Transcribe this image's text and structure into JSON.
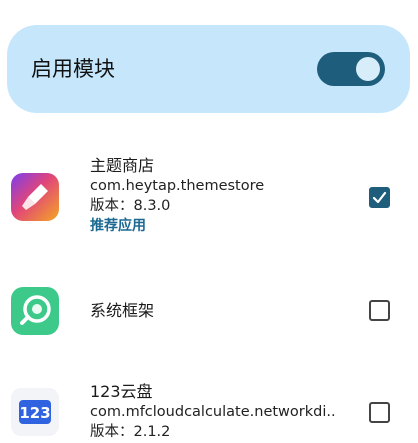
{
  "header": {
    "title": "启用模块",
    "toggle_on": true
  },
  "apps": [
    {
      "name": "主题商店",
      "package": "com.heytap.themestore",
      "version": "版本：8.3.0",
      "recommendation": "推荐应用",
      "checked": true,
      "icon": "theme-store-brush-icon"
    },
    {
      "name": "系统框架",
      "checked": false,
      "icon": "system-framework-icon"
    },
    {
      "name": "123云盘",
      "package": "com.mfcloudcalculate.networkdi..",
      "version": "版本：2.1.2",
      "checked": false,
      "icon": "cloud-disk-123-icon",
      "icon_text": "123"
    }
  ],
  "colors": {
    "card_bg": "#c6e7fb",
    "accent": "#1f5d7c",
    "link": "#1c6a92"
  }
}
